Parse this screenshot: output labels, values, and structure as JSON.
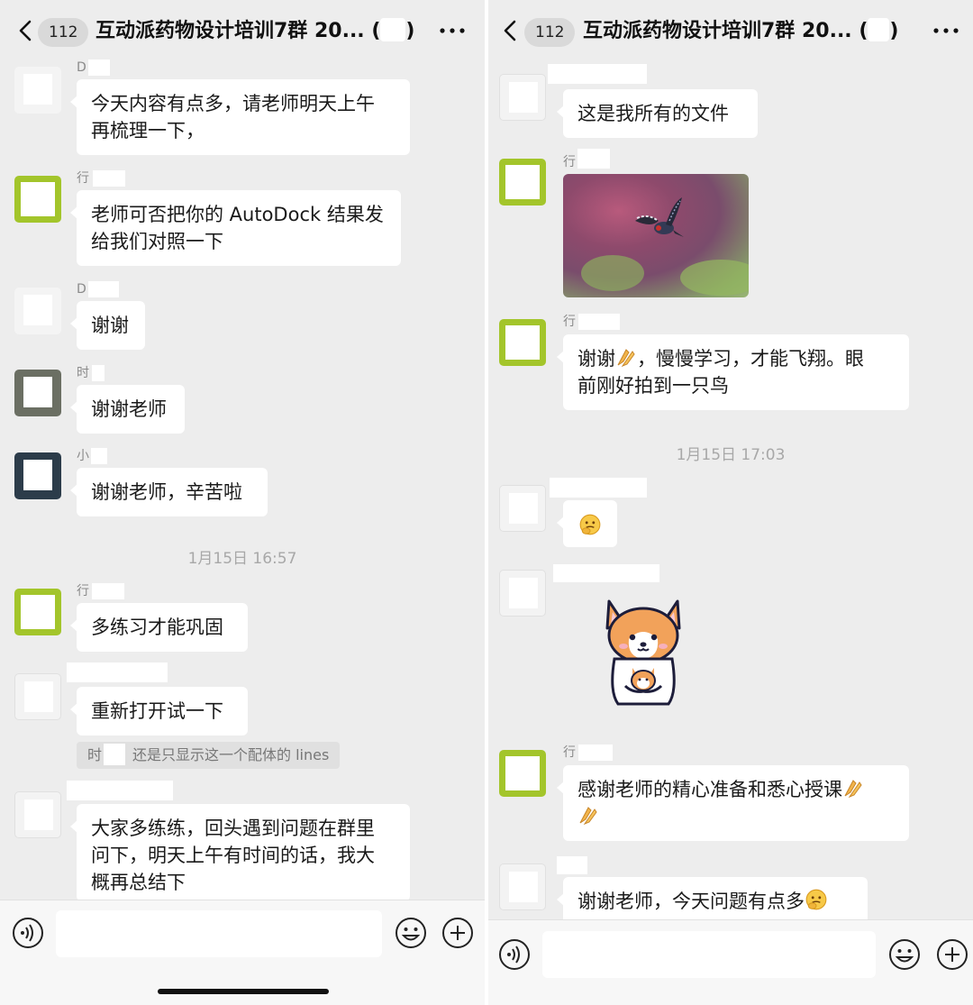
{
  "left": {
    "header": {
      "unread_count": "112",
      "title": "互动派药物设计培训7群 20... (",
      "title_tail": ")"
    },
    "messages": [
      {
        "sender": "D",
        "text_lines": [
          "今天内容有点多，请老师明天上午",
          "再梳理一下，"
        ]
      },
      {
        "sender": "行",
        "text_lines": [
          "老师可否把你的 AutoDock 结果发",
          "给我们对照一下"
        ]
      },
      {
        "sender": "D",
        "text": "谢谢"
      },
      {
        "sender": "时",
        "text": "谢谢老师"
      },
      {
        "sender": "小",
        "text": "谢谢老师，辛苦啦"
      },
      {
        "sender": "行",
        "text": "多练习才能巩固"
      },
      {
        "sender": "",
        "text": "重新打开试一下"
      },
      {
        "sender": "",
        "text_lines": [
          "大家多练练，回头遇到问题在群里",
          "问下，明天上午有时间的话，我大",
          "概再总结下"
        ]
      }
    ],
    "timestamp": "1月15日 16:57",
    "quote": {
      "prefix": "时",
      "text": "还是只显示这一个配体的 lines"
    }
  },
  "right": {
    "header": {
      "unread_count": "112",
      "title": "互动派药物设计培训7群 20... (",
      "title_tail": ")"
    },
    "messages": [
      {
        "sender": "",
        "text": "这是我所有的文件"
      },
      {
        "sender": "行",
        "image": "bird-photo"
      },
      {
        "sender": "行",
        "text_lines": [
          "谢谢",
          "，慢慢学习，才能飞翔。眼",
          "前刚好拍到一只鸟"
        ]
      },
      {
        "sender": "",
        "emoji": "thinking-face"
      },
      {
        "sender": "",
        "sticker": "corgi-sticker"
      },
      {
        "sender": "行",
        "text_lines": [
          "感谢老师的精心准备和悉心授课"
        ]
      },
      {
        "sender": "",
        "text": "谢谢老师，今天问题有点多"
      }
    ],
    "timestamp": "1月15日 17:03"
  },
  "icons": [
    "back-icon",
    "more-icon",
    "voice-icon",
    "emoji-icon",
    "plus-icon",
    "praying-hands-icon",
    "thinking-face-icon",
    "bird-photo",
    "corgi-sticker"
  ],
  "colors": {
    "chat_bg": "#ededed",
    "bubble": "#ffffff",
    "timestamp": "#a8a8a8",
    "avatar_green": "#a3c52b"
  }
}
